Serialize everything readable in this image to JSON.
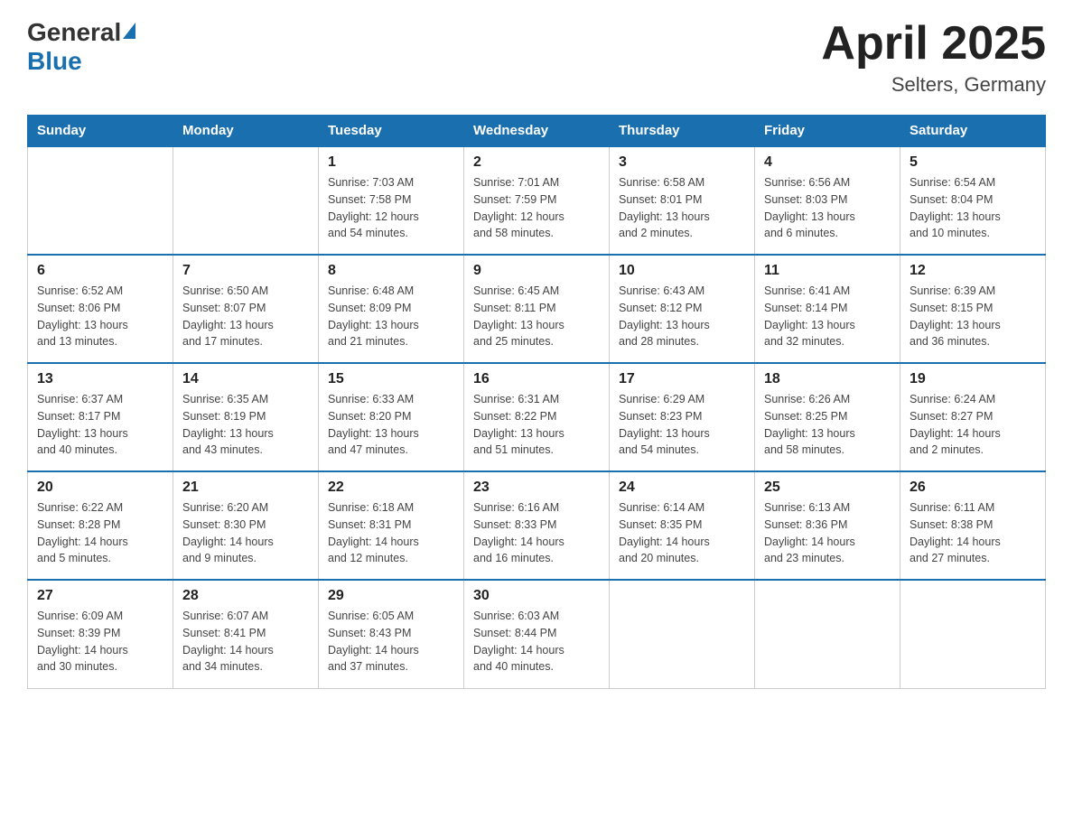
{
  "header": {
    "logo_general": "General",
    "logo_blue": "Blue",
    "month_year": "April 2025",
    "location": "Selters, Germany"
  },
  "weekdays": [
    "Sunday",
    "Monday",
    "Tuesday",
    "Wednesday",
    "Thursday",
    "Friday",
    "Saturday"
  ],
  "weeks": [
    [
      {
        "day": "",
        "info": ""
      },
      {
        "day": "",
        "info": ""
      },
      {
        "day": "1",
        "info": "Sunrise: 7:03 AM\nSunset: 7:58 PM\nDaylight: 12 hours\nand 54 minutes."
      },
      {
        "day": "2",
        "info": "Sunrise: 7:01 AM\nSunset: 7:59 PM\nDaylight: 12 hours\nand 58 minutes."
      },
      {
        "day": "3",
        "info": "Sunrise: 6:58 AM\nSunset: 8:01 PM\nDaylight: 13 hours\nand 2 minutes."
      },
      {
        "day": "4",
        "info": "Sunrise: 6:56 AM\nSunset: 8:03 PM\nDaylight: 13 hours\nand 6 minutes."
      },
      {
        "day": "5",
        "info": "Sunrise: 6:54 AM\nSunset: 8:04 PM\nDaylight: 13 hours\nand 10 minutes."
      }
    ],
    [
      {
        "day": "6",
        "info": "Sunrise: 6:52 AM\nSunset: 8:06 PM\nDaylight: 13 hours\nand 13 minutes."
      },
      {
        "day": "7",
        "info": "Sunrise: 6:50 AM\nSunset: 8:07 PM\nDaylight: 13 hours\nand 17 minutes."
      },
      {
        "day": "8",
        "info": "Sunrise: 6:48 AM\nSunset: 8:09 PM\nDaylight: 13 hours\nand 21 minutes."
      },
      {
        "day": "9",
        "info": "Sunrise: 6:45 AM\nSunset: 8:11 PM\nDaylight: 13 hours\nand 25 minutes."
      },
      {
        "day": "10",
        "info": "Sunrise: 6:43 AM\nSunset: 8:12 PM\nDaylight: 13 hours\nand 28 minutes."
      },
      {
        "day": "11",
        "info": "Sunrise: 6:41 AM\nSunset: 8:14 PM\nDaylight: 13 hours\nand 32 minutes."
      },
      {
        "day": "12",
        "info": "Sunrise: 6:39 AM\nSunset: 8:15 PM\nDaylight: 13 hours\nand 36 minutes."
      }
    ],
    [
      {
        "day": "13",
        "info": "Sunrise: 6:37 AM\nSunset: 8:17 PM\nDaylight: 13 hours\nand 40 minutes."
      },
      {
        "day": "14",
        "info": "Sunrise: 6:35 AM\nSunset: 8:19 PM\nDaylight: 13 hours\nand 43 minutes."
      },
      {
        "day": "15",
        "info": "Sunrise: 6:33 AM\nSunset: 8:20 PM\nDaylight: 13 hours\nand 47 minutes."
      },
      {
        "day": "16",
        "info": "Sunrise: 6:31 AM\nSunset: 8:22 PM\nDaylight: 13 hours\nand 51 minutes."
      },
      {
        "day": "17",
        "info": "Sunrise: 6:29 AM\nSunset: 8:23 PM\nDaylight: 13 hours\nand 54 minutes."
      },
      {
        "day": "18",
        "info": "Sunrise: 6:26 AM\nSunset: 8:25 PM\nDaylight: 13 hours\nand 58 minutes."
      },
      {
        "day": "19",
        "info": "Sunrise: 6:24 AM\nSunset: 8:27 PM\nDaylight: 14 hours\nand 2 minutes."
      }
    ],
    [
      {
        "day": "20",
        "info": "Sunrise: 6:22 AM\nSunset: 8:28 PM\nDaylight: 14 hours\nand 5 minutes."
      },
      {
        "day": "21",
        "info": "Sunrise: 6:20 AM\nSunset: 8:30 PM\nDaylight: 14 hours\nand 9 minutes."
      },
      {
        "day": "22",
        "info": "Sunrise: 6:18 AM\nSunset: 8:31 PM\nDaylight: 14 hours\nand 12 minutes."
      },
      {
        "day": "23",
        "info": "Sunrise: 6:16 AM\nSunset: 8:33 PM\nDaylight: 14 hours\nand 16 minutes."
      },
      {
        "day": "24",
        "info": "Sunrise: 6:14 AM\nSunset: 8:35 PM\nDaylight: 14 hours\nand 20 minutes."
      },
      {
        "day": "25",
        "info": "Sunrise: 6:13 AM\nSunset: 8:36 PM\nDaylight: 14 hours\nand 23 minutes."
      },
      {
        "day": "26",
        "info": "Sunrise: 6:11 AM\nSunset: 8:38 PM\nDaylight: 14 hours\nand 27 minutes."
      }
    ],
    [
      {
        "day": "27",
        "info": "Sunrise: 6:09 AM\nSunset: 8:39 PM\nDaylight: 14 hours\nand 30 minutes."
      },
      {
        "day": "28",
        "info": "Sunrise: 6:07 AM\nSunset: 8:41 PM\nDaylight: 14 hours\nand 34 minutes."
      },
      {
        "day": "29",
        "info": "Sunrise: 6:05 AM\nSunset: 8:43 PM\nDaylight: 14 hours\nand 37 minutes."
      },
      {
        "day": "30",
        "info": "Sunrise: 6:03 AM\nSunset: 8:44 PM\nDaylight: 14 hours\nand 40 minutes."
      },
      {
        "day": "",
        "info": ""
      },
      {
        "day": "",
        "info": ""
      },
      {
        "day": "",
        "info": ""
      }
    ]
  ]
}
